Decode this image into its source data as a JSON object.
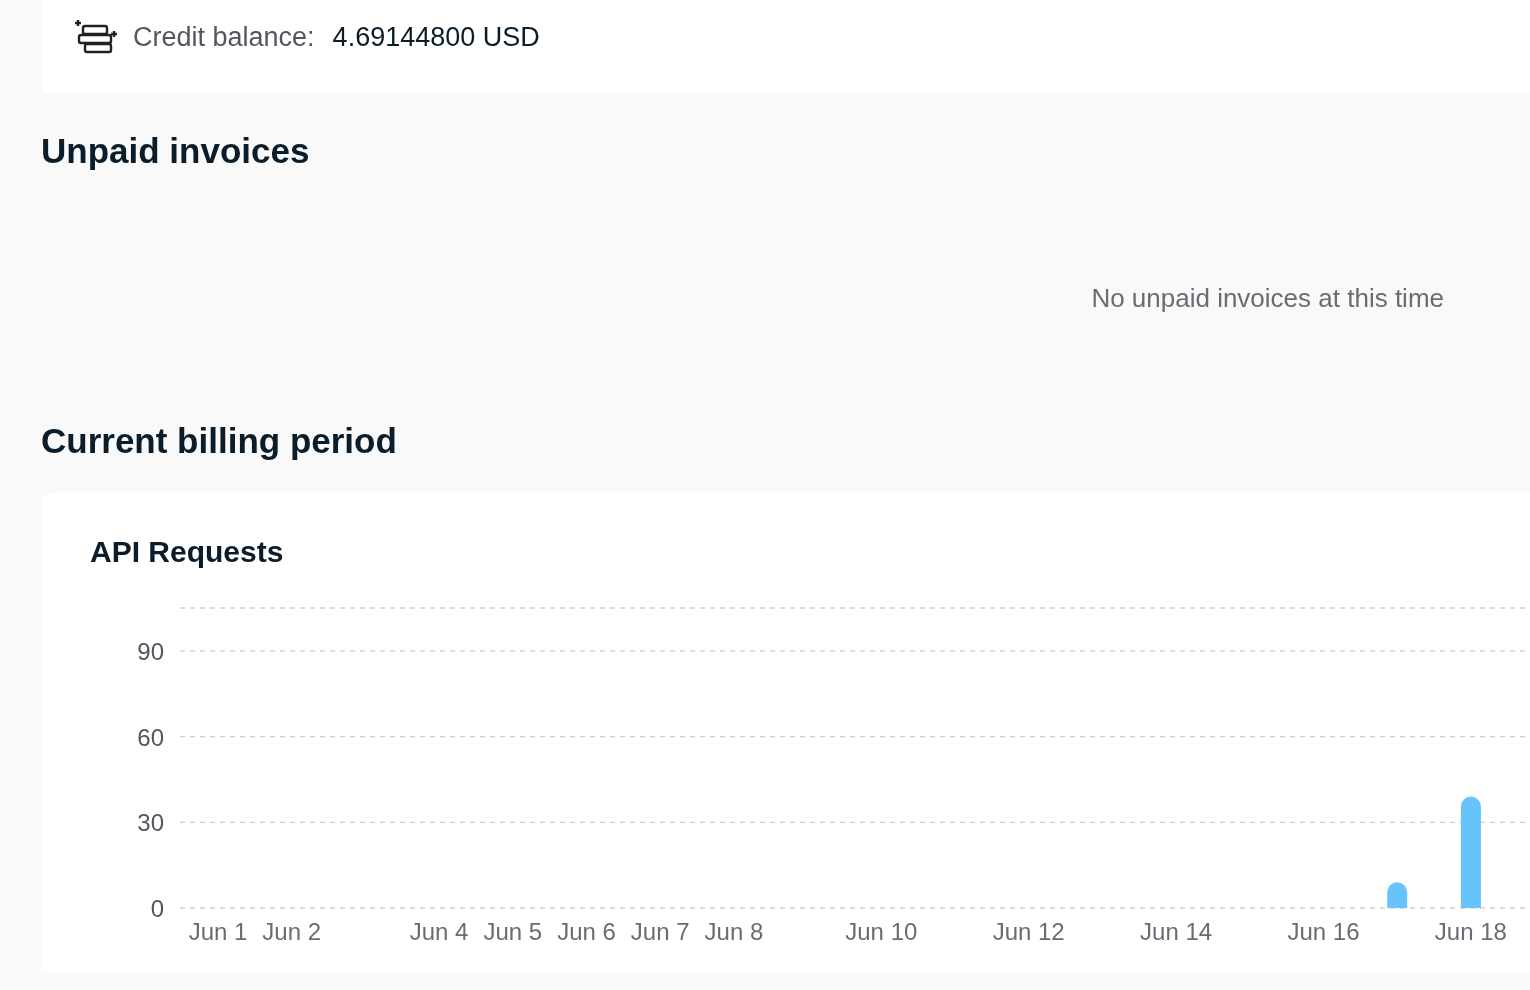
{
  "credit": {
    "label": "Credit balance:",
    "value": "4.69144800 USD"
  },
  "unpaid_invoices": {
    "title": "Unpaid invoices",
    "empty_message": "No unpaid invoices at this time"
  },
  "billing_period": {
    "title": "Current billing period",
    "card": {
      "title": "API Requests",
      "chart_data": {
        "type": "bar",
        "categories": [
          "Jun 1",
          "Jun 2",
          null,
          "Jun 4",
          "Jun 5",
          "Jun 6",
          "Jun 7",
          "Jun 8",
          null,
          "Jun 10",
          null,
          "Jun 12",
          null,
          "Jun 14",
          null,
          "Jun 16",
          null,
          "Jun 18"
        ],
        "series": [
          {
            "color": "#66c4fa",
            "values": [
              0,
              0,
              0,
              0,
              0,
              0,
              0,
              0,
              0,
              0,
              0,
              0,
              0,
              0,
              0,
              0,
              9,
              39
            ]
          }
        ],
        "grid": true,
        "ylim": [
          0,
          105
        ],
        "yticks": [
          0,
          30,
          60,
          90
        ]
      }
    }
  }
}
